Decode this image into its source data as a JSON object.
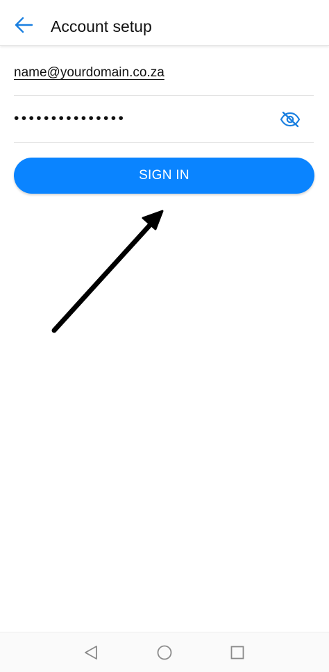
{
  "header": {
    "title": "Account setup",
    "back_icon": "arrow-left-icon"
  },
  "form": {
    "email_value": "name@yourdomain.co.za",
    "password_masked": "•••••••••••••••",
    "toggle_icon": "eye-off-icon"
  },
  "actions": {
    "sign_in_label": "SIGN IN"
  },
  "navigation": {
    "back_icon": "triangle-back-icon",
    "home_icon": "circle-home-icon",
    "recents_icon": "square-recents-icon"
  },
  "colors": {
    "accent": "#0a84ff",
    "annotation_arrow": "#000000"
  }
}
